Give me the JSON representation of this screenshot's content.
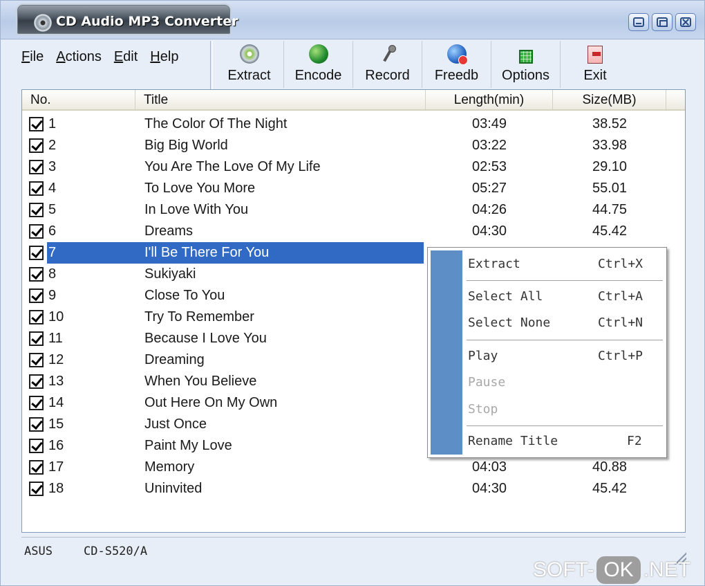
{
  "window": {
    "title": "CD Audio MP3 Converter"
  },
  "menu": [
    {
      "pre": "",
      "ul": "F",
      "post": "ile"
    },
    {
      "pre": "",
      "ul": "A",
      "post": "ctions"
    },
    {
      "pre": "",
      "ul": "E",
      "post": "dit"
    },
    {
      "pre": "",
      "ul": "H",
      "post": "elp"
    }
  ],
  "toolbar": [
    {
      "label": "Extract",
      "icon": "extract-icon"
    },
    {
      "label": "Encode",
      "icon": "encode-icon"
    },
    {
      "label": "Record",
      "icon": "record-icon"
    },
    {
      "label": "Freedb",
      "icon": "freedb-icon"
    },
    {
      "label": "Options",
      "icon": "options-icon"
    },
    {
      "label": "Exit",
      "icon": "exit-icon"
    }
  ],
  "table": {
    "headers": [
      "No.",
      "Title",
      "Length(min)",
      "Size(MB)"
    ],
    "rows": [
      {
        "no": "1",
        "title": "The Color Of The Night",
        "length": "03:49",
        "size": "38.52",
        "checked": true
      },
      {
        "no": "2",
        "title": "Big Big World",
        "length": "03:22",
        "size": "33.98",
        "checked": true
      },
      {
        "no": "3",
        "title": "You Are The Love Of My Life",
        "length": "02:53",
        "size": "29.10",
        "checked": true
      },
      {
        "no": "4",
        "title": "To Love You More",
        "length": "05:27",
        "size": "55.01",
        "checked": true
      },
      {
        "no": "5",
        "title": "In Love With You",
        "length": "04:26",
        "size": "44.75",
        "checked": true
      },
      {
        "no": "6",
        "title": "Dreams",
        "length": "04:30",
        "size": "45.42",
        "checked": true
      },
      {
        "no": "7",
        "title": "I'll Be There For You",
        "length": "",
        "size": "",
        "checked": true,
        "selected": true
      },
      {
        "no": "8",
        "title": "Sukiyaki",
        "length": "",
        "size": "",
        "checked": true
      },
      {
        "no": "9",
        "title": "Close To You",
        "length": "",
        "size": "",
        "checked": true
      },
      {
        "no": "10",
        "title": "Try To Remember",
        "length": "",
        "size": "",
        "checked": true
      },
      {
        "no": "11",
        "title": "Because I Love You",
        "length": "",
        "size": "",
        "checked": true
      },
      {
        "no": "12",
        "title": "Dreaming",
        "length": "",
        "size": "",
        "checked": true
      },
      {
        "no": "13",
        "title": "When You Believe",
        "length": "",
        "size": "",
        "checked": true
      },
      {
        "no": "14",
        "title": "Out Here On My Own",
        "length": "",
        "size": "",
        "checked": true
      },
      {
        "no": "15",
        "title": "Just Once",
        "length": "",
        "size": "",
        "checked": true
      },
      {
        "no": "16",
        "title": "Paint My Love",
        "length": "",
        "size": "",
        "checked": true
      },
      {
        "no": "17",
        "title": "Memory",
        "length": "04:03",
        "size": "40.88",
        "checked": true
      },
      {
        "no": "18",
        "title": "Uninvited",
        "length": "04:30",
        "size": "45.42",
        "checked": true
      }
    ]
  },
  "context_menu": {
    "items": [
      {
        "label": "Extract",
        "shortcut": "Ctrl+X",
        "disabled": false
      },
      {
        "label": "Select All",
        "shortcut": "Ctrl+A",
        "disabled": false
      },
      {
        "label": "Select None",
        "shortcut": "Ctrl+N",
        "disabled": false
      },
      {
        "label": "Play",
        "shortcut": "Ctrl+P",
        "disabled": false
      },
      {
        "label": "Pause",
        "shortcut": "",
        "disabled": true
      },
      {
        "label": "Stop",
        "shortcut": "",
        "disabled": true
      },
      {
        "label": "Rename Title",
        "shortcut": "F2",
        "disabled": false
      }
    ]
  },
  "status": {
    "vendor": "ASUS",
    "drive": "CD-S520/A"
  },
  "watermark": {
    "left": "SOFT-",
    "box": "OK",
    "right": ".NET"
  },
  "colors": {
    "selection": "#316ac5",
    "menu_side": "#5d8fc6",
    "frame": "#e8eef7"
  }
}
